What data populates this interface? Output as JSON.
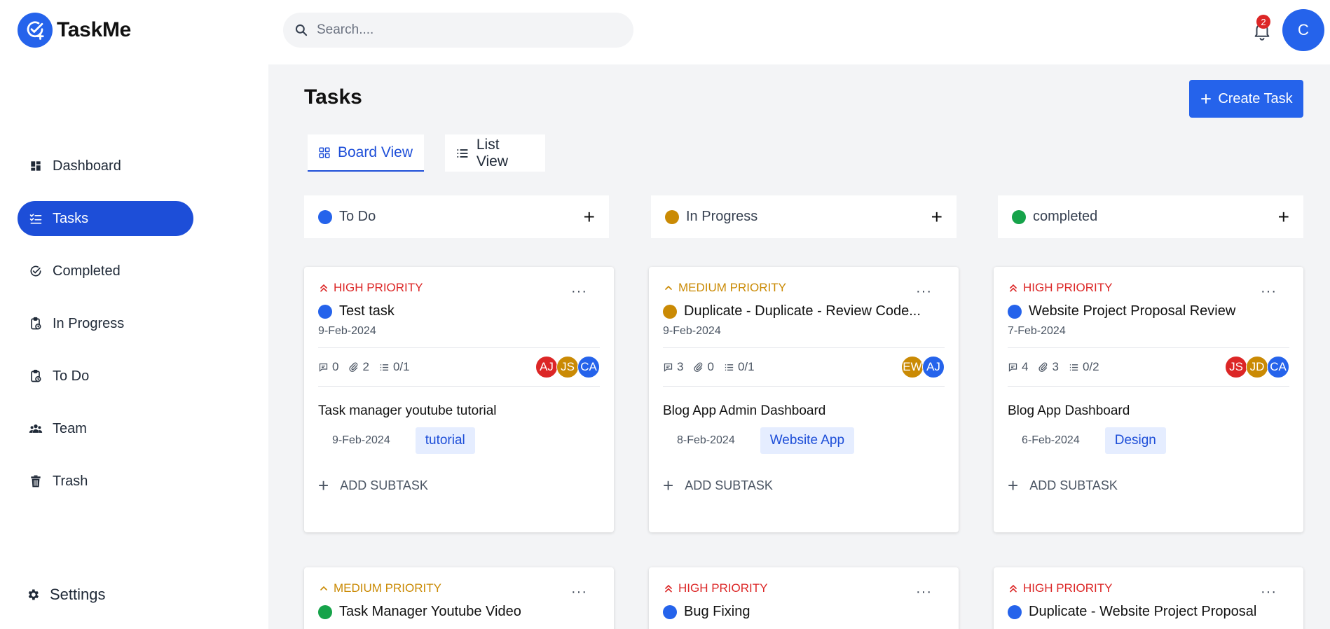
{
  "app": {
    "name": "TaskMe"
  },
  "colors": {
    "primary": "#2563eb",
    "todo": "#2563eb",
    "in_progress": "#ca8a04",
    "completed": "#16a34a",
    "high": "#dc2626",
    "medium": "#ca8a04"
  },
  "sidebar": {
    "items": [
      {
        "label": "Dashboard",
        "icon": "dashboard-icon"
      },
      {
        "label": "Tasks",
        "icon": "tasks-icon",
        "active": true
      },
      {
        "label": "Completed",
        "icon": "check-circle-icon"
      },
      {
        "label": "In Progress",
        "icon": "clipboard-icon"
      },
      {
        "label": "To Do",
        "icon": "clipboard-icon"
      },
      {
        "label": "Team",
        "icon": "users-icon"
      },
      {
        "label": "Trash",
        "icon": "trash-icon"
      }
    ],
    "settings_label": "Settings"
  },
  "header": {
    "search_placeholder": "Search....",
    "notification_count": "2",
    "user_initial": "C"
  },
  "main": {
    "title": "Tasks",
    "create_label": "Create Task",
    "tabs": [
      {
        "label": "Board View"
      },
      {
        "label": "List View"
      }
    ],
    "columns": [
      {
        "label": "To Do"
      },
      {
        "label": "In Progress"
      },
      {
        "label": "completed"
      }
    ],
    "cards": [
      {
        "priority": "HIGH PRIORITY",
        "title": "Test task",
        "date": "9-Feb-2024",
        "comments": "0",
        "attachments": "2",
        "subtasks": "0/1",
        "avatars": [
          "AJ",
          "JS",
          "CA"
        ],
        "subtask_title": "Task manager youtube tutorial",
        "subtask_date": "9-Feb-2024",
        "tag": "tutorial",
        "add_label": "ADD SUBTASK"
      },
      {
        "priority": "MEDIUM PRIORITY",
        "title": "Duplicate - Duplicate - Review Code...",
        "date": "9-Feb-2024",
        "comments": "3",
        "attachments": "0",
        "subtasks": "0/1",
        "avatars": [
          "EW",
          "AJ"
        ],
        "subtask_title": "Blog App Admin Dashboard",
        "subtask_date": "8-Feb-2024",
        "tag": "Website App",
        "add_label": "ADD SUBTASK"
      },
      {
        "priority": "HIGH PRIORITY",
        "title": "Website Project Proposal Review",
        "date": "7-Feb-2024",
        "comments": "4",
        "attachments": "3",
        "subtasks": "0/2",
        "avatars": [
          "JS",
          "JD",
          "CA"
        ],
        "subtask_title": "Blog App Dashboard",
        "subtask_date": "6-Feb-2024",
        "tag": "Design",
        "add_label": "ADD SUBTASK"
      },
      {
        "priority": "MEDIUM PRIORITY",
        "title": "Task Manager Youtube Video"
      },
      {
        "priority": "HIGH PRIORITY",
        "title": "Bug Fixing"
      },
      {
        "priority": "HIGH PRIORITY",
        "title": "Duplicate - Website Project Proposal"
      }
    ]
  }
}
